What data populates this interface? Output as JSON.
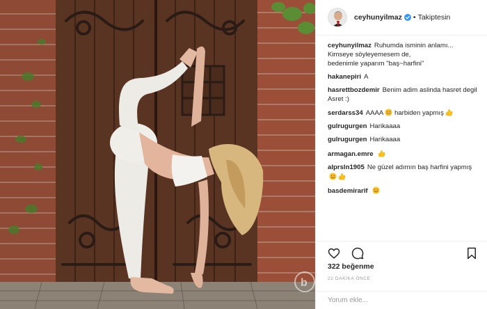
{
  "post": {
    "username": "ceyhunyilmaz",
    "verified": true,
    "follow_status": "Takiptesin",
    "separator": "•",
    "photo_alt": "photo",
    "watermark": "b"
  },
  "comments": [
    {
      "user": "ceyhunyilmaz",
      "text": "Ruhumda isminin anlamı...\nKimseye söyleyemesem de,\nbedenimle yaparım \"baş~harfini\"",
      "emojis": []
    },
    {
      "user": "hakanepiri",
      "text": "A",
      "emojis": []
    },
    {
      "user": "hasrettbozdemir",
      "text": "Benim adim aslinda hasret degil Asret :)",
      "emojis": []
    },
    {
      "user": "serdarss34",
      "text": "AAAA",
      "emojis": [
        "grin-sweat-emoji"
      ],
      "text2": " harbiden yapmış",
      "emojis2": [
        "thumbs-up-emoji"
      ]
    },
    {
      "user": "gulrugurgen",
      "text": "Harikaaaa",
      "emojis": []
    },
    {
      "user": "gulrugurgen",
      "text": "Harikaaaa",
      "emojis": []
    },
    {
      "user": "armagan.emre",
      "text": "",
      "emojis": [
        "thumbs-up-emoji"
      ]
    },
    {
      "user": "alprsln1905",
      "text": "Ne güzel adımın baş harfini yapmış",
      "emojis": [
        "smile-emoji",
        "thumbs-up-emoji"
      ]
    },
    {
      "user": "basdemirarif",
      "text": "",
      "emojis": [
        "smile-emoji"
      ]
    }
  ],
  "actions": {
    "like_icon": "heart-icon",
    "comment_icon": "comment-icon",
    "save_icon": "bookmark-icon"
  },
  "likes_text": "322 beğenme",
  "time_ago": "22 DAKİKA ÖNCE",
  "add_comment": {
    "placeholder": "Yorum ekle..."
  },
  "colors": {
    "text": "#262626",
    "muted": "#999999",
    "verified": "#3897f0",
    "border": "#efefef",
    "emoji": "#fcc21b"
  }
}
